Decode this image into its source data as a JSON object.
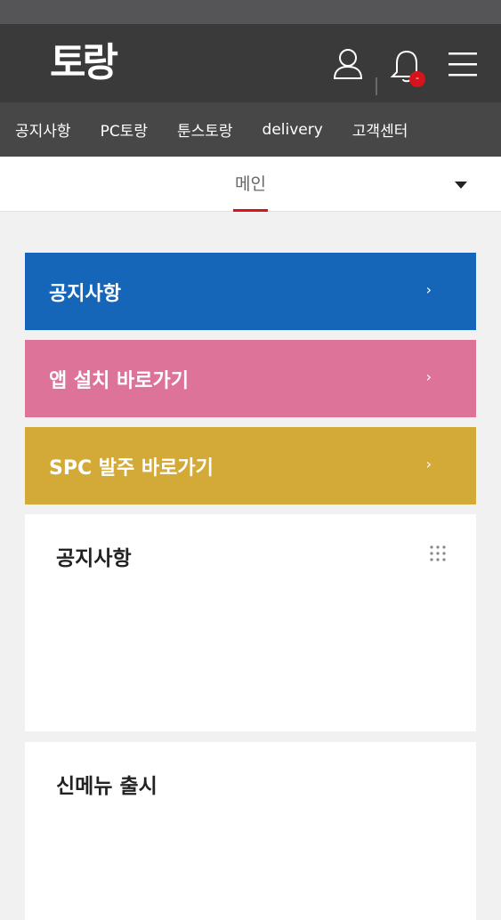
{
  "header": {
    "logo_text": "토랑",
    "notification_badge": "-"
  },
  "nav": {
    "items": [
      {
        "label": "공지사항"
      },
      {
        "label": "PC토랑"
      },
      {
        "label": "툰스토랑"
      },
      {
        "label": "delivery"
      },
      {
        "label": "고객센터"
      }
    ]
  },
  "tabs": {
    "active_label": "메인"
  },
  "banners": [
    {
      "label": "공지사항",
      "arrow": "›",
      "color": "#1565b8"
    },
    {
      "label": "앱 설치 바로가기",
      "arrow": "›",
      "color": "#de7399"
    },
    {
      "label": "SPC 발주 바로가기",
      "arrow": "›",
      "color": "#d3a938"
    }
  ],
  "cards": [
    {
      "title": "공지사항"
    },
    {
      "title": "신메뉴 출시"
    }
  ],
  "colors": {
    "accent_red": "#d7141b",
    "header_bg": "#3b3a3b",
    "nav_bg": "#484748"
  }
}
